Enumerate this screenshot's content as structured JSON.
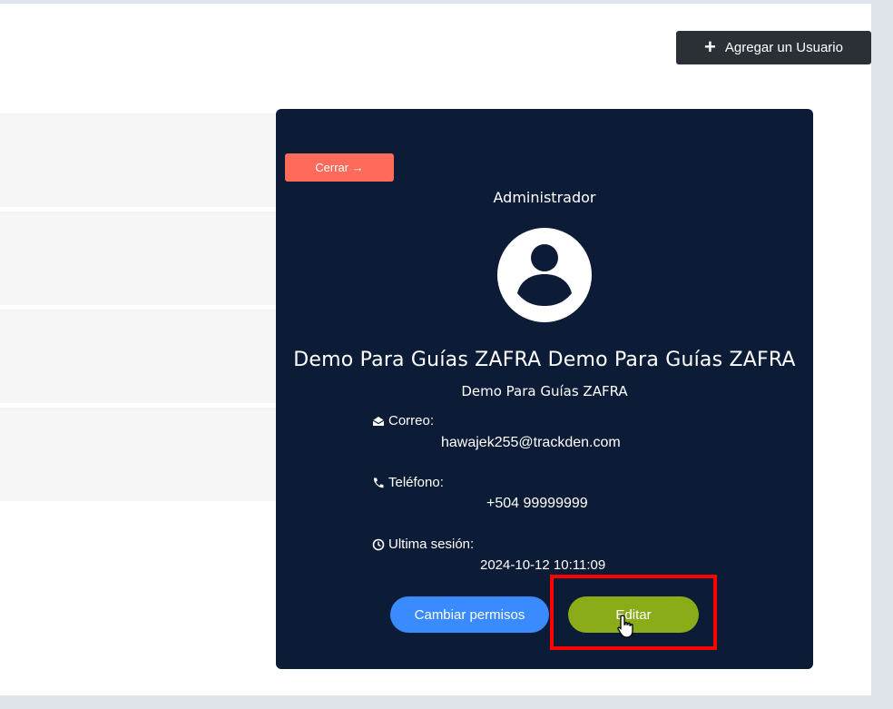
{
  "header": {
    "add_user_label": "Agregar un Usuario"
  },
  "card": {
    "close_label": "Cerrar →",
    "role": "Administrador",
    "full_name": "Demo Para Guías ZAFRA Demo Para Guías ZAFRA",
    "org_name": "Demo Para Guías ZAFRA",
    "email_label": "Correo:",
    "email_value": "hawajek255@trackden.com",
    "phone_label": "Teléfono:",
    "phone_value": "+504 99999999",
    "session_label": "Ultima sesión:",
    "session_value": "2024-10-12 10:11:09",
    "change_permissions_label": "Cambiar permisos",
    "edit_label": "Editar"
  },
  "colors": {
    "card_bg": "#0c1b36",
    "close_button": "#ff6b5a",
    "permissions_button": "#3a8bff",
    "edit_button": "#8aac19",
    "add_user_button": "#2b2f36",
    "highlight": "#ff0000"
  },
  "icons": {
    "add": "plus-icon",
    "avatar": "user-avatar-icon",
    "email": "envelope-open-icon",
    "phone": "phone-icon",
    "session": "clock-icon",
    "cursor": "hand-pointer-icon"
  }
}
